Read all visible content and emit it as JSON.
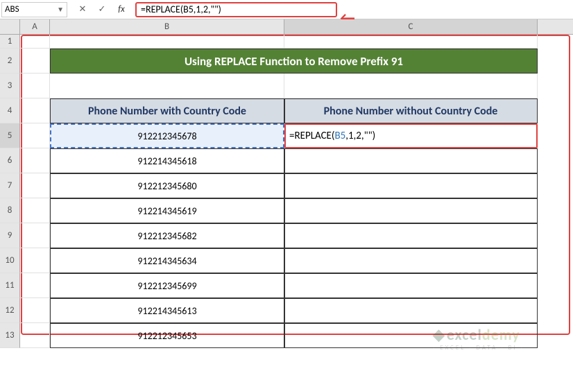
{
  "nameBox": "ABS",
  "formulaBar": "=REPLACE(B5,1,2,\"\")",
  "columns": [
    "A",
    "B",
    "C"
  ],
  "rows": [
    "1",
    "2",
    "3",
    "4",
    "5",
    "6",
    "7",
    "8",
    "9",
    "10",
    "11",
    "12",
    "13"
  ],
  "title": "Using REPLACE Function to Remove Prefix 91",
  "headers": {
    "B": "Phone Number with Country Code",
    "C": "Phone Number without Country Code"
  },
  "activeCellFormula": {
    "prefix": "=REPLACE(",
    "ref": "B5",
    "suffix": ",1,2,\"\")"
  },
  "data": [
    "912212345678",
    "912214345618",
    "912212345680",
    "912214345619",
    "912212345682",
    "912214345634",
    "912212345699",
    "912214345613",
    "912212345653"
  ],
  "watermark": {
    "brand1": "excel",
    "brand2": "demy",
    "tagline": "· EXCEL · DATA · BI ·"
  }
}
